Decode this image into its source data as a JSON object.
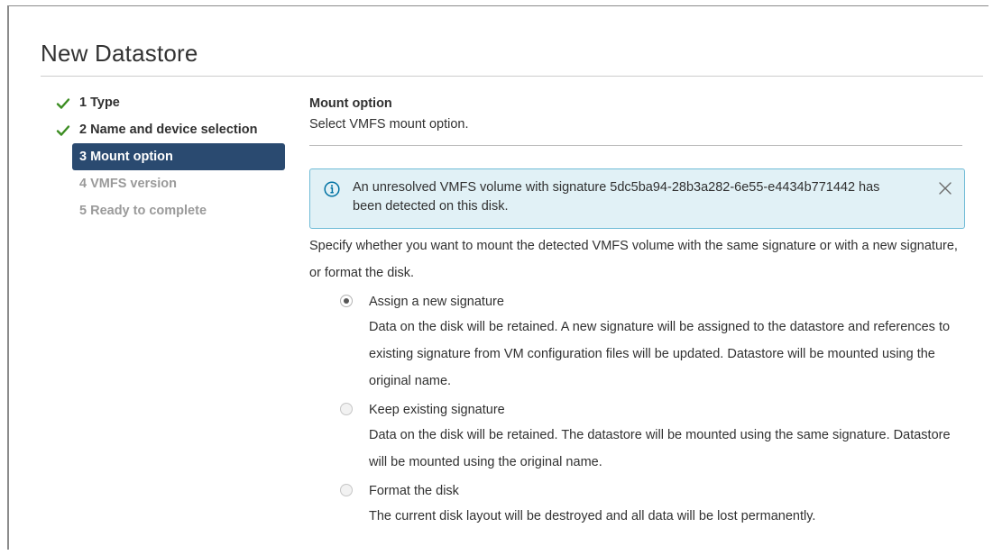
{
  "dialog": {
    "title": "New Datastore"
  },
  "steps": [
    {
      "label": "1 Type",
      "state": "done"
    },
    {
      "label": "2 Name and device selection",
      "state": "done"
    },
    {
      "label": "3 Mount option",
      "state": "active"
    },
    {
      "label": "4 VMFS version",
      "state": "future"
    },
    {
      "label": "5 Ready to complete",
      "state": "future"
    }
  ],
  "content": {
    "heading": "Mount option",
    "subheading": "Select VMFS mount option.",
    "alert": {
      "message": "An unresolved VMFS volume with signature 5dc5ba94-28b3a282-6e55-e4434b771442 has been detected on this disk.",
      "icon": "info-icon",
      "close_icon": "close-icon"
    },
    "intro": "Specify whether you want to mount the detected VMFS volume with the same signature or with a new signature, or format the disk.",
    "options": [
      {
        "label": "Assign a new signature",
        "description": "Data on the disk will be retained. A new signature will be assigned to the datastore and references to existing signature from VM configuration files will be updated. Datastore will be mounted using the original name.",
        "selected": true
      },
      {
        "label": "Keep existing signature",
        "description": "Data on the disk will be retained. The datastore will be mounted using the same signature. Datastore will be mounted using the original name.",
        "selected": false
      },
      {
        "label": "Format the disk",
        "description": "The current disk layout will be destroyed and all data will be lost permanently.",
        "selected": false
      }
    ]
  },
  "colors": {
    "active_step_bg": "#2a4a70",
    "check_green": "#3c8d22",
    "alert_bg": "#e1f1f6",
    "alert_border": "#6fbbd6",
    "info_blue": "#0072a3"
  }
}
